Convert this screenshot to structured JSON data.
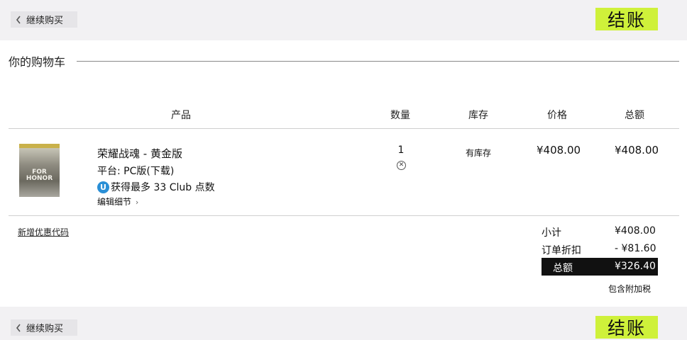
{
  "header": {
    "back_label": "继续购买",
    "checkout_label": "结账"
  },
  "footer": {
    "back_label": "继续购买",
    "checkout_label": "结账"
  },
  "cart": {
    "title": "你的购物车",
    "columns": {
      "product": "产品",
      "quantity": "数量",
      "stock": "库存",
      "price": "价格",
      "total": "总额"
    },
    "item": {
      "cover_text": "FOR HONOR",
      "name": "荣耀战魂 - 黄金版",
      "platform": "平台: PC版(下载)",
      "club_icon": "U",
      "club_points": "获得最多 33 Club 点数",
      "edit_label": "编辑细节",
      "quantity": "1",
      "stock": "有库存",
      "price": "¥408.00",
      "total": "¥408.00"
    },
    "coupon_label": "新增优惠代码",
    "summary": {
      "subtotal_label": "小计",
      "subtotal_value": "¥408.00",
      "discount_label": "订单折扣",
      "discount_value": "- ¥81.60",
      "grand_label": "总额",
      "grand_value": "¥326.40",
      "tax_note": "包含附加税"
    }
  },
  "colors": {
    "accent": "#cff13a",
    "bar_bg": "#f2f1f3",
    "grand_bg": "#111111"
  },
  "icons": {
    "back": "chevron-left-icon",
    "remove": "remove-circle-icon",
    "club": "uplay-icon",
    "edit": "chevron-right-icon"
  }
}
